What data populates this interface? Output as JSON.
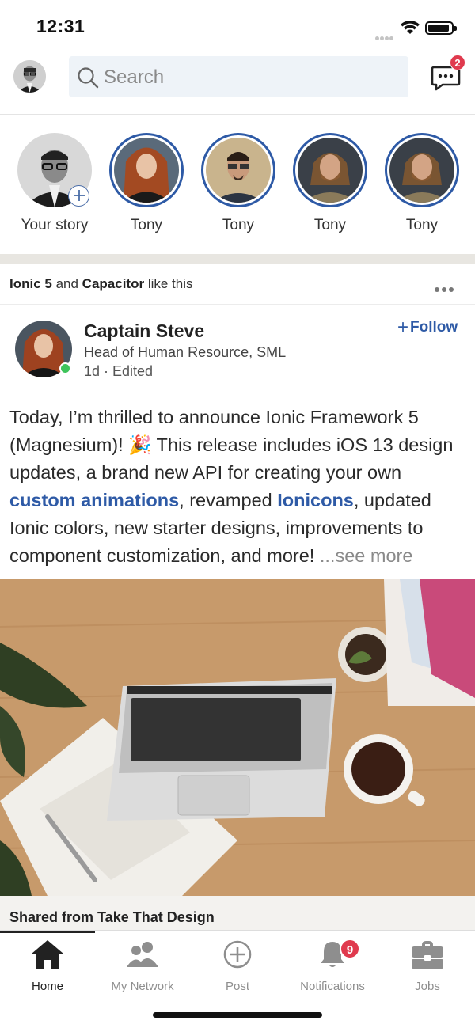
{
  "status_bar": {
    "time": "12:31"
  },
  "header": {
    "search_placeholder": "Search",
    "messages_badge": "2"
  },
  "stories": [
    {
      "name": "Your story"
    },
    {
      "name": "Tony"
    },
    {
      "name": "Tony"
    },
    {
      "name": "Tony"
    },
    {
      "name": "Tony"
    }
  ],
  "post": {
    "liked_by_1": "Ionic 5",
    "liked_and": " and ",
    "liked_by_2": "Capacitor",
    "liked_suffix": " like this",
    "author_name": "Captain Steve",
    "author_role": "Head of Human Resource, SML",
    "posted": "1d · Edited",
    "follow_label": "Follow",
    "text_part1": "Today, I’m thrilled to announce Ionic Framework 5 (Magnesium)! 🎉 This release includes iOS 13 design updates, a brand new API for creating your own ",
    "link1": "custom animations",
    "text_part2": ", revamped ",
    "link2": "Ionicons",
    "text_part3": ", updated Ionic colors, new starter designs, improvements to component customization, and more! ",
    "see_more": "...see more",
    "shared_from": "Shared from Take That Design"
  },
  "tabs": [
    {
      "label": "Home",
      "active": true
    },
    {
      "label": "My Network"
    },
    {
      "label": "Post"
    },
    {
      "label": "Notifications",
      "badge": "9"
    },
    {
      "label": "Jobs"
    }
  ],
  "colors": {
    "accent": "#2e5aa6",
    "badge": "#e03a4e",
    "online": "#3ec45b"
  }
}
